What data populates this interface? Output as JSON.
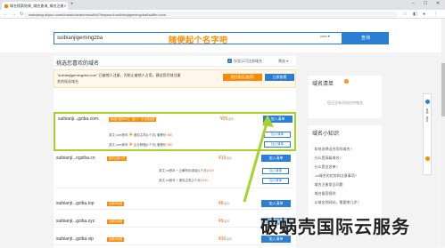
{
  "browser": {
    "tab_title": "域名搜索结果_域名查询_域名注册",
    "new_tab": "+",
    "url": "wanwang.aliyun.com/domain/searchresult/#/?keyword=suibianjigemingzba&suffix=com"
  },
  "search": {
    "value": "suibianjigemingzba",
    "slogan": "随便起个名字吧",
    "suffix": ".com ▾",
    "button": "查询"
  },
  "main": {
    "title": "挑选您喜欢的域名",
    "checkbox_label": "仅显示可注册域名",
    "filter": "筛选 ▾",
    "notice_line1": "\"suibianjigemingzba.com\" 已被他人注册，为防止被他人占用，建议您尽快注册",
    "notice_line2": "其他候选域名",
    "notice_btn1": "委托购买(推荐)",
    "notice_btn2": "立即查看"
  },
  "rows": [
    {
      "domain": "suibianji...gziba.com",
      "tag": "新用户首年55元 · 限1个 · 不支持续费",
      "price": "¥55",
      "unit": "/首年",
      "button": "加入清单"
    },
    {
      "domain": "suibianji...ngziba.cn",
      "tag": "首年注册19元",
      "price": "¥19",
      "unit": "/首年",
      "button": "加入清单"
    },
    {
      "domain": "suibianji...gziba.top",
      "tag": "注册享优惠",
      "price": "¥8",
      "unit": "/首年",
      "button": "加入清单"
    },
    {
      "domain": "suibianji...gziba.xyz",
      "tag": "注册享优惠",
      "price": "¥9",
      "unit": "/首年",
      "button": "加入清单"
    },
    {
      "domain": "suibianji...gziba.vip",
      "tag": "注册享优惠",
      "price": "¥16",
      "unit": "/首年",
      "button": "加入清单"
    }
  ],
  "highlight": {
    "sub1_a": "英文.com首年",
    "sub1_b": "虚拟主机(1个月)",
    "sub1_c": "套餐价",
    "sub1_price": "¥80",
    "sub1_btn": "加入清单",
    "sub2_a": "英文.com首年",
    "sub2_b": "企业邮箱(1个月)",
    "sub2_c": "套餐价",
    "sub2_price": "¥80",
    "sub2_btn": "加入清单"
  },
  "cn_row_subs": [
    {
      "text": "英文.cn首年 + 云解析标准版(1个月)",
      "price": "¥29",
      "btn": "加入清单"
    },
    {
      "text": "英文.cn首年 + 虚拟主机(1个月)",
      "price": "¥49",
      "btn": "加入清单"
    }
  ],
  "sidebar": {
    "cart_title": "域名清单",
    "cart_badge": "0",
    "cart_empty": "您还没有添加任何域名",
    "tips_title": "域名小知识",
    "tips": [
      "如何选择适合您的域名?",
      "什么是高级域名?",
      "什么是白名单?",
      ".cn域名的优势和注意事项?",
      "域名注册常见问题",
      "域名备案规则",
      "从域名到网站，需要哪几步?"
    ]
  },
  "float_tool": {
    "label": "咨询 · 建议"
  },
  "watermark": "破蜗壳国际云服务"
}
